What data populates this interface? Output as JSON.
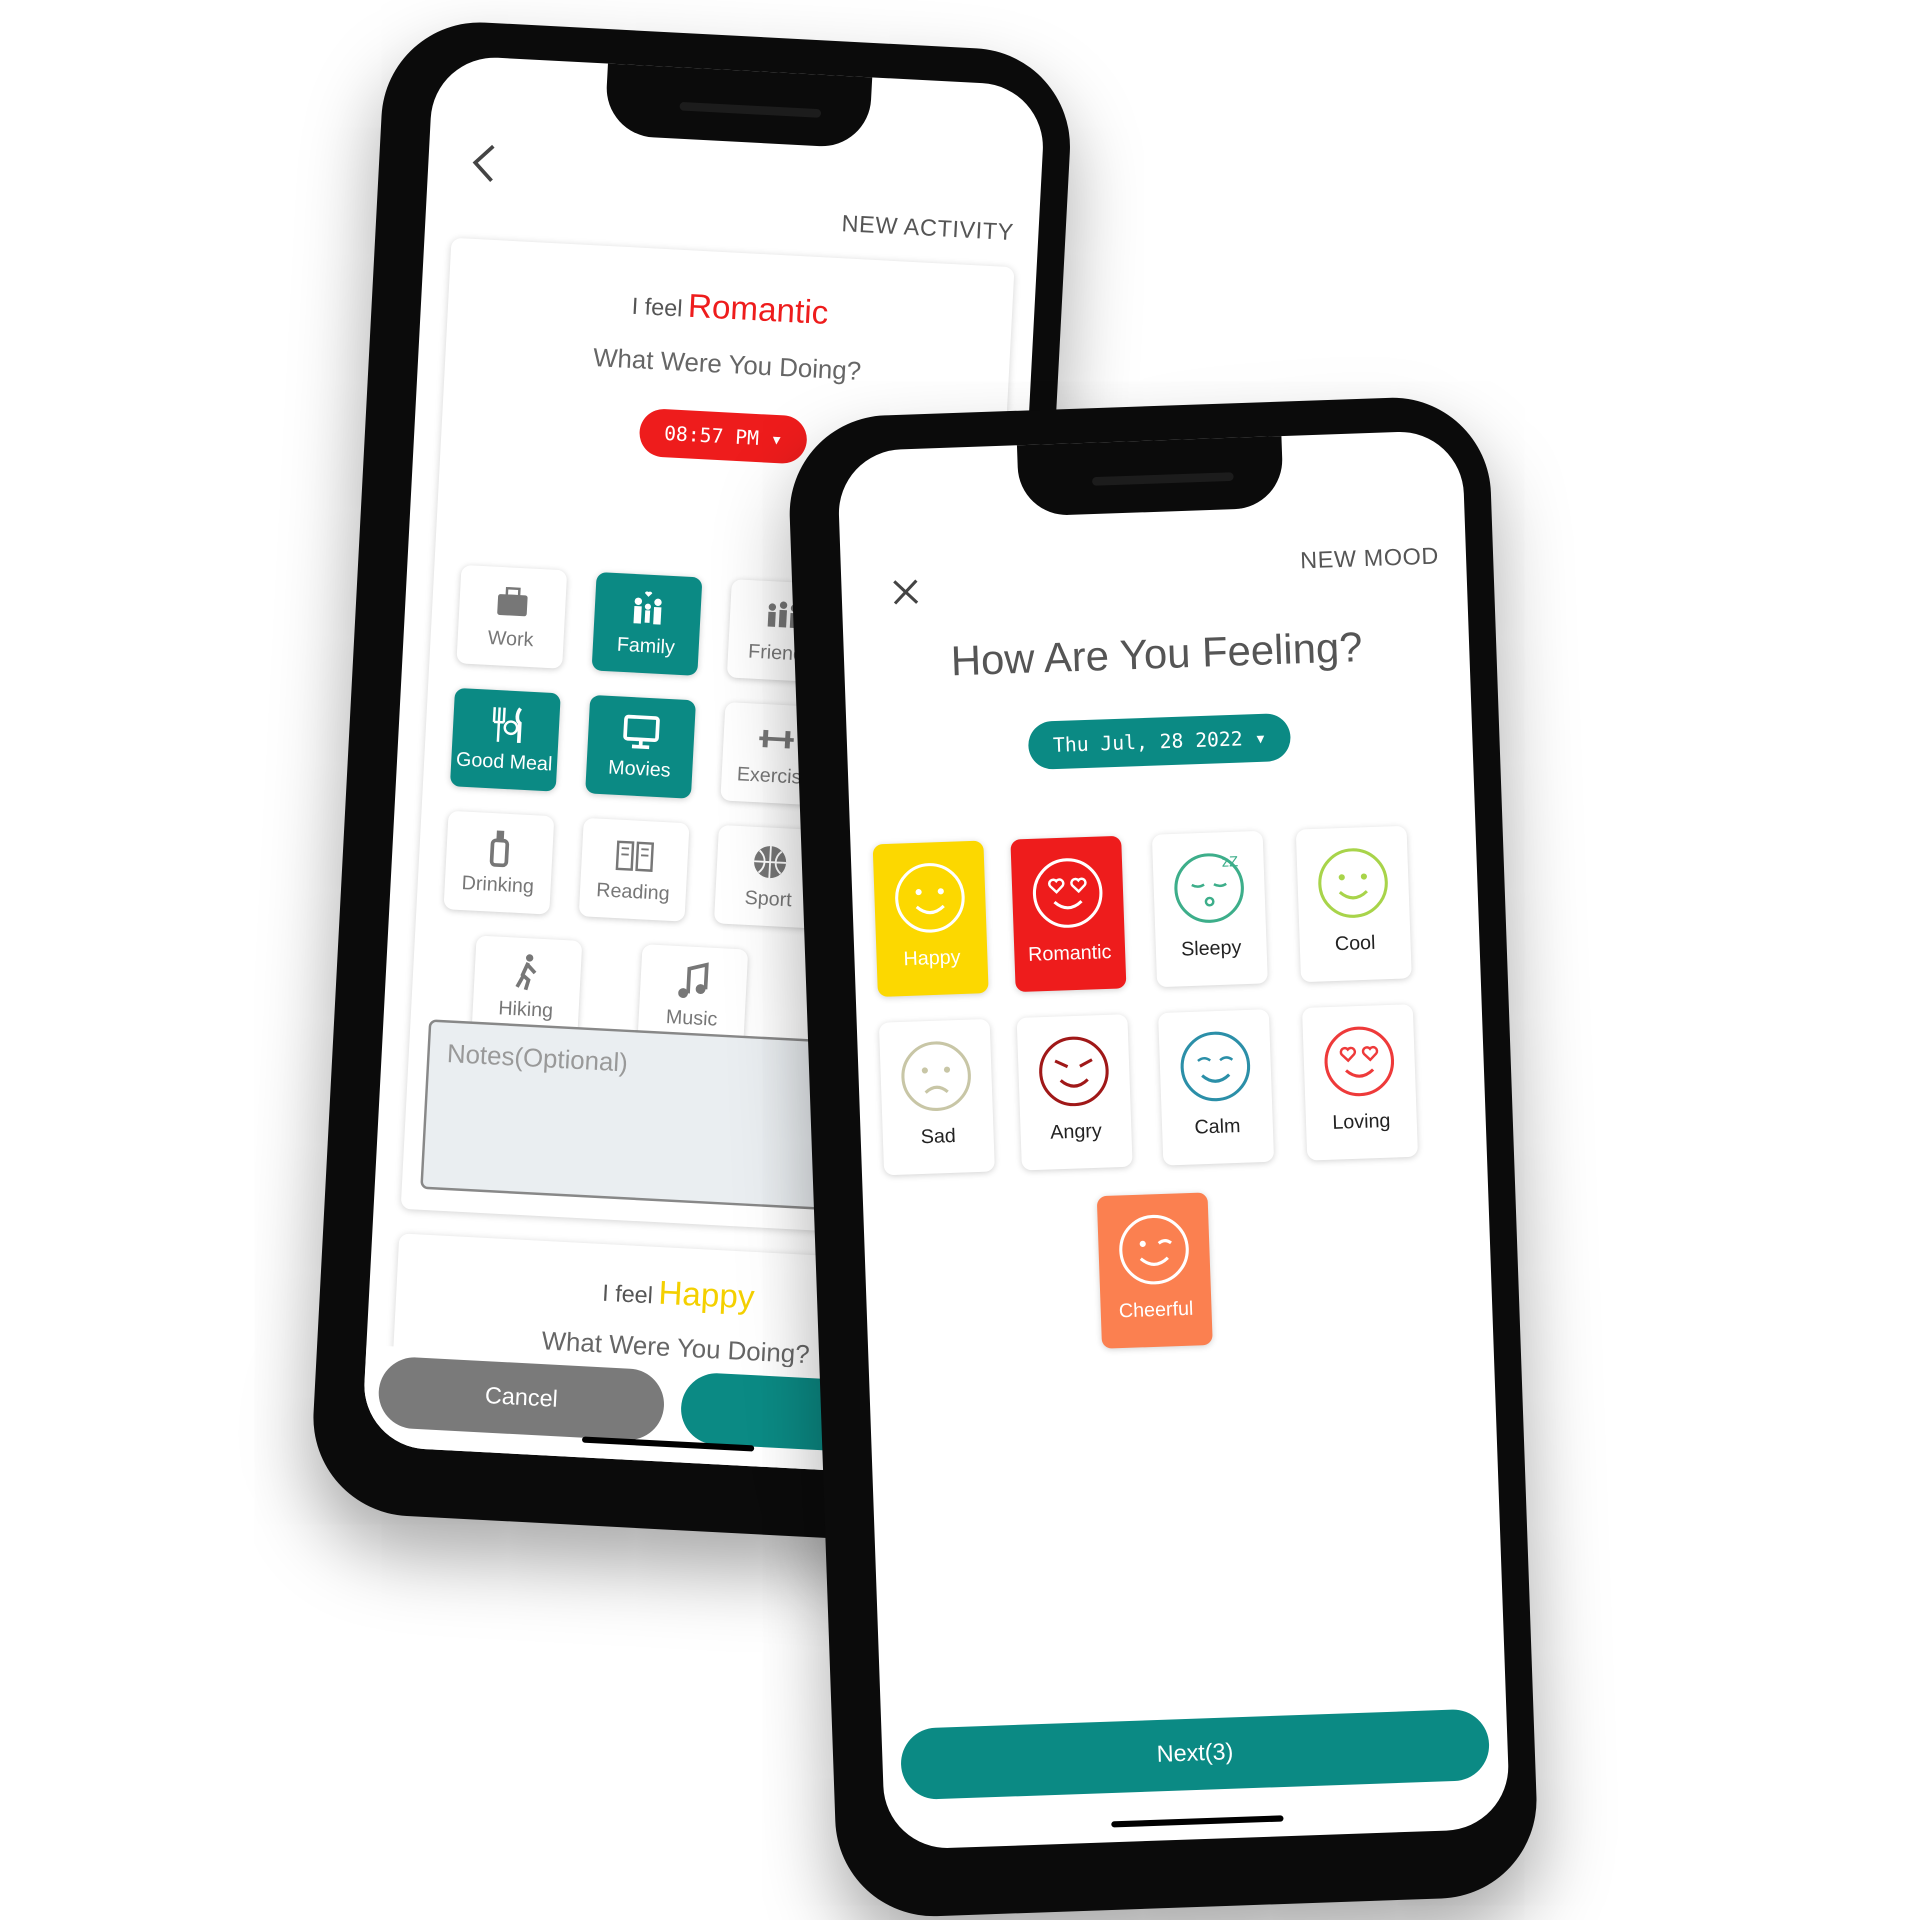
{
  "activity_screen": {
    "title": "NEW ACTIVITY",
    "cards": [
      {
        "prefix": "I feel",
        "mood": "Romantic",
        "mood_color": "#ee1c1c",
        "question": "What Were You Doing?",
        "time": "08:57 PM"
      },
      {
        "prefix": "I feel",
        "mood": "Happy",
        "mood_color": "#f4d000",
        "question": "What Were You Doing?"
      }
    ],
    "activities": [
      {
        "label": "Work",
        "icon": "briefcase-icon",
        "selected": false
      },
      {
        "label": "Family",
        "icon": "family-icon",
        "selected": true
      },
      {
        "label": "Friends",
        "icon": "friends-icon",
        "selected": false
      },
      {
        "label": "Good Meal",
        "icon": "utensils-icon",
        "selected": true
      },
      {
        "label": "Movies",
        "icon": "monitor-icon",
        "selected": true
      },
      {
        "label": "Exercise",
        "icon": "dumbbell-icon",
        "selected": false
      },
      {
        "label": "Drinking",
        "icon": "bottle-icon",
        "selected": false
      },
      {
        "label": "Reading",
        "icon": "book-icon",
        "selected": false
      },
      {
        "label": "Sport",
        "icon": "basketball-icon",
        "selected": false
      },
      {
        "label": "Hiking",
        "icon": "hiking-icon",
        "selected": false
      },
      {
        "label": "Music",
        "icon": "music-icon",
        "selected": false
      }
    ],
    "notes_placeholder": "Notes(Optional)",
    "cancel_label": "Cancel"
  },
  "mood_screen": {
    "title": "NEW MOOD",
    "heading": "How Are You Feeling?",
    "date": "Thu Jul, 28 2022",
    "moods": [
      {
        "label": "Happy",
        "bg": "#fcd800",
        "fg": "#fff",
        "stroke": "#fff",
        "selected": true
      },
      {
        "label": "Romantic",
        "bg": "#ee1c1c",
        "fg": "#fff",
        "stroke": "#fff",
        "selected": true
      },
      {
        "label": "Sleepy",
        "bg": "#fff",
        "fg": "#222",
        "stroke": "#3dae8a",
        "selected": false
      },
      {
        "label": "Cool",
        "bg": "#fff",
        "fg": "#222",
        "stroke": "#a8d44a",
        "selected": false
      },
      {
        "label": "Sad",
        "bg": "#fff",
        "fg": "#222",
        "stroke": "#c8c6a6",
        "selected": false
      },
      {
        "label": "Angry",
        "bg": "#fff",
        "fg": "#222",
        "stroke": "#a01818",
        "selected": false
      },
      {
        "label": "Calm",
        "bg": "#fff",
        "fg": "#222",
        "stroke": "#2b8fa8",
        "selected": false
      },
      {
        "label": "Loving",
        "bg": "#fff",
        "fg": "#222",
        "stroke": "#ee3a3a",
        "selected": false
      },
      {
        "label": "Cheerful",
        "bg": "#fb8050",
        "fg": "#fff",
        "stroke": "#fff",
        "selected": true
      }
    ],
    "next_label": "Next(3)"
  },
  "colors": {
    "teal": "#0b8a84",
    "gray_button": "#7a7a7a"
  }
}
